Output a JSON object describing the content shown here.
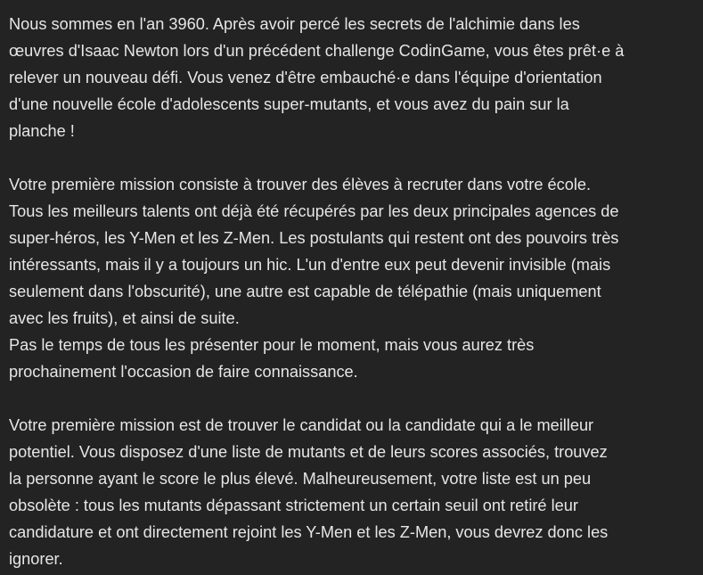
{
  "paragraphs": [
    {
      "lines": [
        "Nous sommes en l'an 3960. Après avoir percé les secrets de l'alchimie dans les",
        "œuvres d'Isaac Newton lors d'un précédent challenge CodinGame, vous êtes prêt·e à",
        "relever un nouveau défi. Vous venez d'être embauché·e dans l'équipe d'orientation",
        "d'une nouvelle école d'adolescents super-mutants, et vous avez du pain sur la",
        "planche !"
      ]
    },
    {
      "lines": [
        "Votre première mission consiste à trouver des élèves à recruter dans votre école.",
        "Tous les meilleurs talents ont déjà été récupérés par les deux principales agences de",
        "super-héros, les Y-Men et les Z-Men. Les postulants qui restent ont des pouvoirs très",
        "intéressants, mais il y a toujours un hic. L'un d'entre eux peut devenir invisible (mais",
        "seulement dans l'obscurité), une autre est capable de télépathie (mais uniquement",
        "avec les fruits), et ainsi de suite.",
        "Pas le temps de tous les présenter pour le moment, mais vous aurez très",
        "prochainement l'occasion de faire connaissance."
      ]
    },
    {
      "lines": [
        "Votre première mission est de trouver le candidat ou la candidate qui a le meilleur",
        "potentiel. Vous disposez d'une liste de mutants et de leurs scores associés, trouvez",
        "la personne ayant le score le plus élevé. Malheureusement, votre liste est un peu",
        "obsolète : tous les mutants dépassant strictement un certain seuil ont retiré leur",
        "candidature et ont directement rejoint les Y-Men et les Z-Men, vous devrez donc les",
        "ignorer."
      ]
    }
  ]
}
